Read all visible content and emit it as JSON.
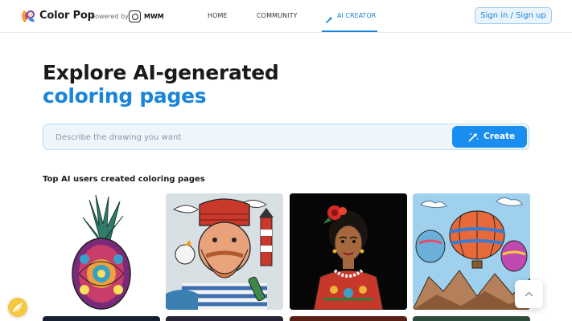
{
  "brand": {
    "name": "Color Pop",
    "powered_by": "powered by",
    "partner": "MWM"
  },
  "nav": {
    "items": [
      {
        "label": "HOME",
        "active": false
      },
      {
        "label": "COMMUNITY",
        "active": false
      },
      {
        "label": "AI CREATOR",
        "active": true
      }
    ]
  },
  "auth": {
    "signin_label": "Sign in / Sign up"
  },
  "hero": {
    "line1": "Explore AI-generated",
    "line2": "coloring pages"
  },
  "search": {
    "placeholder": "Describe the drawing you want",
    "value": "",
    "button_label": "Create"
  },
  "gallery": {
    "title": "Top AI users created coloring pages",
    "cards": [
      {
        "icon": "pineapple-mandala-image"
      },
      {
        "icon": "sailor-lighthouse-image"
      },
      {
        "icon": "frida-portrait-image"
      },
      {
        "icon": "hot-air-balloons-image"
      }
    ]
  },
  "colors": {
    "accent": "#1a84d9",
    "button": "#1a8ef0",
    "search_bg": "#eef6fd",
    "promo": "#f5c842"
  }
}
